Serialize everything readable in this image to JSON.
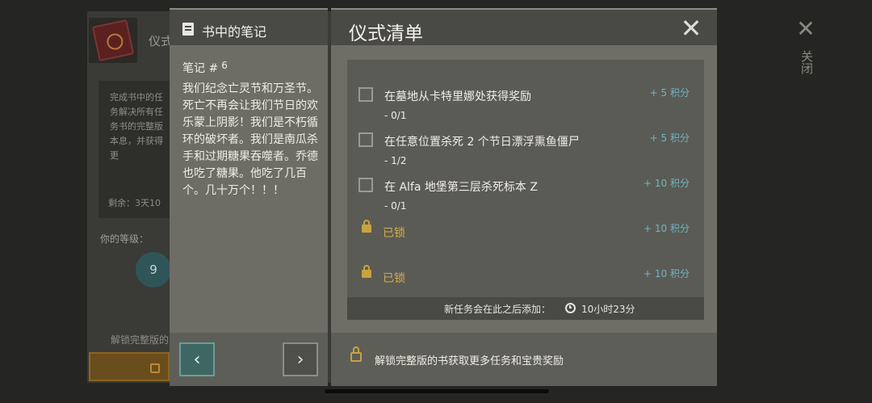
{
  "background": {
    "title": "仪式",
    "card_text": "完成书中的任务解决所有任务书的完整版本息，并获得更",
    "remaining": "剩余：3天10",
    "level_label": "你的等级：",
    "level_value": "9",
    "unlock_text": "解锁完整版的"
  },
  "notes": {
    "title": "书中的笔记",
    "number_label": "笔记 #",
    "number": "6",
    "body": "我们纪念亡灵节和万圣节。死亡不再会让我们节日的欢乐蒙上阴影！我们是不朽循环的破坏者。我们是南瓜杀手和过期糖果吞噬者。乔德也吃了糖果。他吃了几百个。几十万个！！！",
    "prev_icon": "chevron-left-icon",
    "next_icon": "chevron-right-icon"
  },
  "ritual": {
    "title": "仪式清单",
    "close_icon": "close-icon",
    "tasks": [
      {
        "text": "在墓地从卡特里娜处获得奖励",
        "progress": "- 0/1",
        "points": "+ 5  积分"
      },
      {
        "text": "在任意位置杀死 2 个节日漂浮熏鱼僵尸",
        "progress": "- 1/2",
        "points": "+ 5  积分"
      },
      {
        "text": "在 Alfa 地堡第三层杀死标本 Z",
        "progress": "- 0/1",
        "points": "+ 10  积分"
      }
    ],
    "locked": [
      {
        "text": "已锁",
        "points": "+ 10  积分"
      },
      {
        "text": "已锁",
        "points": "+ 10  积分"
      }
    ],
    "new_task_label": "新任务会在此之后添加：",
    "new_task_time": "10小时23分",
    "footer_text": "解锁完整版的书获取更多任务和宝贵奖励"
  },
  "side": {
    "close_label": "关闭"
  },
  "colors": {
    "accent_points": "#6fb5c4",
    "locked_gold": "#d2ae4e",
    "nav_teal": "#3e6764"
  }
}
